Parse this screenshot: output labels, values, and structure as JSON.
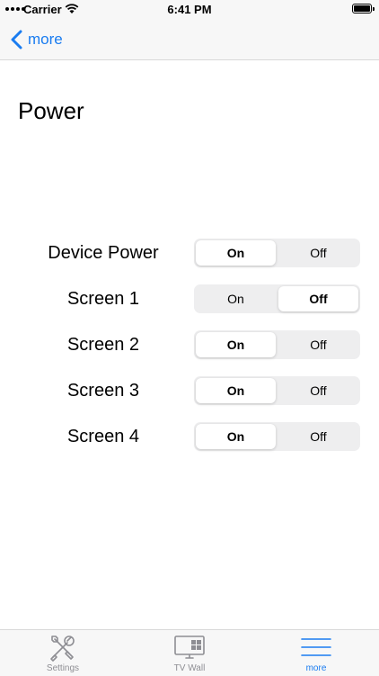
{
  "status_bar": {
    "carrier": "Carrier",
    "time": "6:41 PM"
  },
  "nav": {
    "back_label": "more"
  },
  "page": {
    "title": "Power"
  },
  "rows": [
    {
      "label": "Device Power",
      "on": "On",
      "off": "Off",
      "selected": "on"
    },
    {
      "label": "Screen 1",
      "on": "On",
      "off": "Off",
      "selected": "off"
    },
    {
      "label": "Screen 2",
      "on": "On",
      "off": "Off",
      "selected": "on"
    },
    {
      "label": "Screen 3",
      "on": "On",
      "off": "Off",
      "selected": "on"
    },
    {
      "label": "Screen 4",
      "on": "On",
      "off": "Off",
      "selected": "on"
    }
  ],
  "tabbar": {
    "tabs": [
      {
        "label": "Settings",
        "icon": "tools-icon",
        "active": false
      },
      {
        "label": "TV Wall",
        "icon": "tv-wall-icon",
        "active": false
      },
      {
        "label": "more",
        "icon": "menu-icon",
        "active": true
      }
    ]
  },
  "colors": {
    "accent": "#1a7cf0",
    "inactive": "#8e8e93",
    "segment_bg": "#eeeeef"
  }
}
